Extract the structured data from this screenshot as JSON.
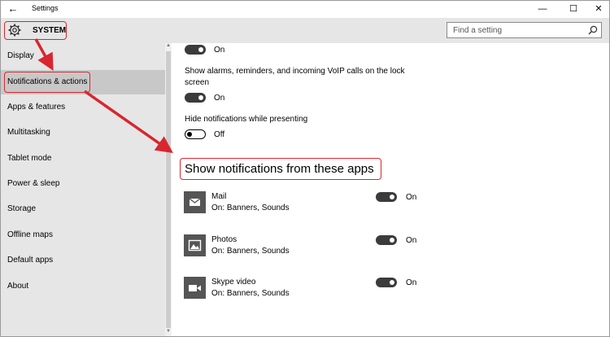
{
  "window": {
    "title": "Settings",
    "minimize": "—",
    "maximize": "☐",
    "close": "✕",
    "back": "←"
  },
  "header": {
    "section": "SYSTEM",
    "search_placeholder": "Find a setting"
  },
  "sidebar": {
    "items": [
      {
        "label": "Display"
      },
      {
        "label": "Notifications & actions"
      },
      {
        "label": "Apps & features"
      },
      {
        "label": "Multitasking"
      },
      {
        "label": "Tablet mode"
      },
      {
        "label": "Power & sleep"
      },
      {
        "label": "Storage"
      },
      {
        "label": "Offline maps"
      },
      {
        "label": "Default apps"
      },
      {
        "label": "About"
      }
    ],
    "selected": "Notifications & actions"
  },
  "content": {
    "top_toggle_state": "On",
    "lock_screen_calls": {
      "label_line1": "Show alarms, reminders, and incoming VoIP calls on the lock",
      "label_line2": "screen",
      "state": "On"
    },
    "hide_presenting": {
      "label": "Hide notifications while presenting",
      "state": "Off"
    },
    "apps_heading": "Show notifications from these apps",
    "apps": [
      {
        "name": "Mail",
        "detail": "On: Banners, Sounds",
        "state": "On",
        "icon": "mail-icon"
      },
      {
        "name": "Photos",
        "detail": "On: Banners, Sounds",
        "state": "On",
        "icon": "photos-icon"
      },
      {
        "name": "Skype video",
        "detail": "On: Banners, Sounds",
        "state": "On",
        "icon": "video-camera-icon"
      }
    ]
  },
  "colors": {
    "annotation_red": "#d9262f",
    "toggle_on": "#3b3b3b",
    "sidebar_bg": "#e6e6e6",
    "selected_bg": "#c8c8c8"
  }
}
